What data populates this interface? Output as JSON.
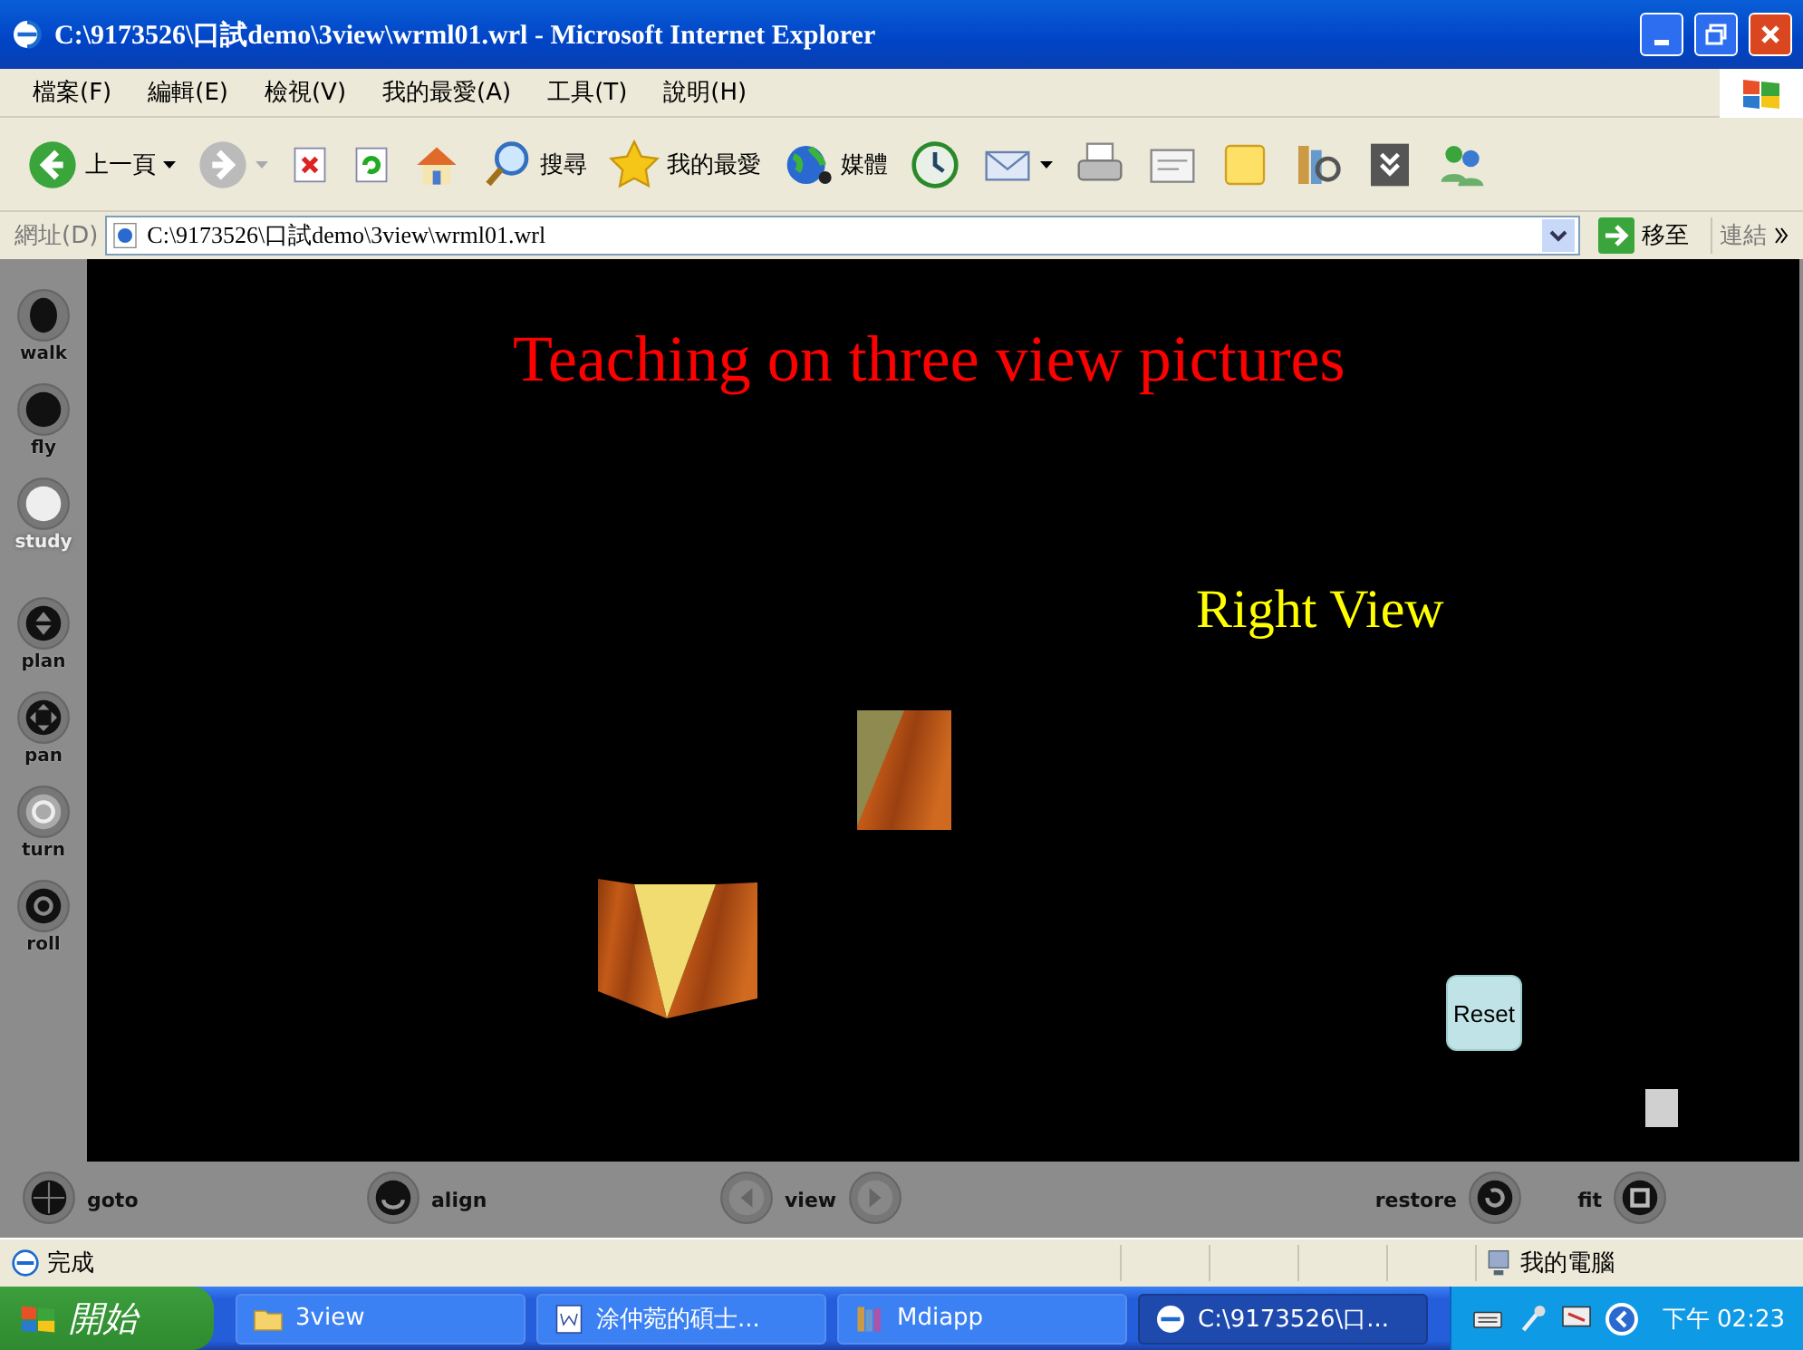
{
  "window": {
    "title": "C:\\9173526\\口試demo\\3view\\wrml01.wrl - Microsoft Internet Explorer"
  },
  "menu": [
    "檔案(F)",
    "編輯(E)",
    "檢視(V)",
    "我的最愛(A)",
    "工具(T)",
    "說明(H)"
  ],
  "toolbar": [
    {
      "kind": "back",
      "label": "上一頁",
      "dropdown": true
    },
    {
      "kind": "forward",
      "dropdown": true,
      "disabled": true
    },
    {
      "kind": "stop"
    },
    {
      "kind": "refresh"
    },
    {
      "kind": "home"
    },
    {
      "kind": "search",
      "label": "搜尋"
    },
    {
      "kind": "favorites",
      "label": "我的最愛"
    },
    {
      "kind": "media",
      "label": "媒體"
    },
    {
      "kind": "history"
    },
    {
      "kind": "mail",
      "dropdown": true
    },
    {
      "kind": "print"
    },
    {
      "kind": "edit"
    },
    {
      "kind": "note"
    },
    {
      "kind": "research"
    },
    {
      "kind": "messenger"
    },
    {
      "kind": "people"
    }
  ],
  "address": {
    "label": "網址(D)",
    "value": "C:\\9173526\\口試demo\\3view\\wrml01.wrl",
    "go": "移至",
    "links": "連結"
  },
  "scene": {
    "title": "Teaching on three view pictures",
    "view_label": "Right View",
    "reset": "Reset"
  },
  "side_nav": [
    {
      "label": "walk",
      "kind": "walk",
      "selected": false
    },
    {
      "label": "fly",
      "kind": "fly",
      "selected": false
    },
    {
      "label": "study",
      "kind": "study",
      "selected": true
    },
    {
      "label": "plan",
      "kind": "plan",
      "selected": false
    },
    {
      "label": "pan",
      "kind": "pan",
      "selected": false
    },
    {
      "label": "turn",
      "kind": "turn",
      "selected": false
    },
    {
      "label": "roll",
      "kind": "roll",
      "selected": false
    }
  ],
  "bottom_nav": [
    {
      "label": "goto",
      "kind": "goto"
    },
    {
      "label": "align",
      "kind": "align"
    },
    {
      "label": "view",
      "kind": "view"
    },
    {
      "label": "restore",
      "kind": "restore"
    },
    {
      "label": "fit",
      "kind": "fit"
    }
  ],
  "status": {
    "text": "完成",
    "zone": "我的電腦"
  },
  "taskbar": {
    "start": "開始",
    "tasks": [
      {
        "label": "3view",
        "kind": "folder",
        "selected": false
      },
      {
        "label": "涂仲菀的碩士...",
        "kind": "word",
        "selected": false
      },
      {
        "label": "Mdiapp",
        "kind": "app",
        "selected": false
      },
      {
        "label": "C:\\9173526\\口...",
        "kind": "ie",
        "selected": true
      }
    ],
    "time": "下午 02:23"
  }
}
